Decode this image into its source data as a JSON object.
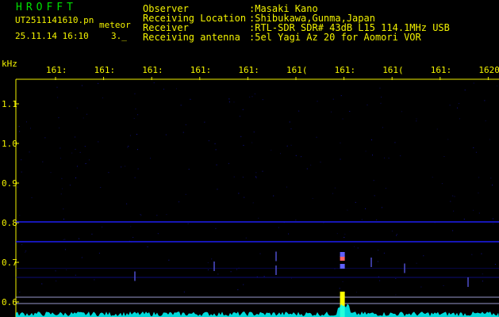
{
  "header": {
    "brand": "HROFFT",
    "file_name": "UT2511141610.pn",
    "mode": "meteor",
    "date_time": "25.11.14 16:10",
    "count": "3._"
  },
  "meta": [
    {
      "label": "Observer",
      "value": ":Masaki Kano"
    },
    {
      "label": "Receiving Location",
      "value": ":Shibukawa,Gunma,Japan"
    },
    {
      "label": "Receiver",
      "value": ":RTL-SDR SDR# 43dB L15 114.1MHz USB"
    },
    {
      "label": "Receiving antenna",
      "value": ":5el Yagi Az 20 for Aomori VOR"
    }
  ],
  "chart_data": {
    "type": "heatmap",
    "title": "",
    "xlabel": "",
    "ylabel": "kHz",
    "x_ticks": [
      "161:",
      "161:",
      "161:",
      "161:",
      "161:",
      "161(",
      "161:",
      "161(",
      "161:",
      "1620"
    ],
    "y_ticks": [
      "1.1",
      "1.0",
      "0.9",
      "0.8",
      "0.7",
      "0.6"
    ],
    "y_range_khz": [
      0.59,
      1.15
    ],
    "horizontal_lines_khz": [
      0.802,
      0.752,
      0.612,
      0.596
    ],
    "meteor_echoes": [
      {
        "tick_index": 6,
        "khz": 0.71,
        "color": "#ff6060"
      },
      {
        "tick_index": 6,
        "khz": 0.72,
        "color": "#6060ff"
      },
      {
        "tick_index": 6,
        "khz": 0.69,
        "color": "#6060ff"
      },
      {
        "tick_index": 6,
        "khz": 0.62,
        "color": "#ffff00"
      }
    ],
    "colors": {
      "background": "#000000",
      "tick": "#f2f200",
      "line": "#2020ff",
      "bottom_line": "#c0c0ff",
      "spectrum": "#00ffff",
      "brand": "#00e000"
    }
  }
}
